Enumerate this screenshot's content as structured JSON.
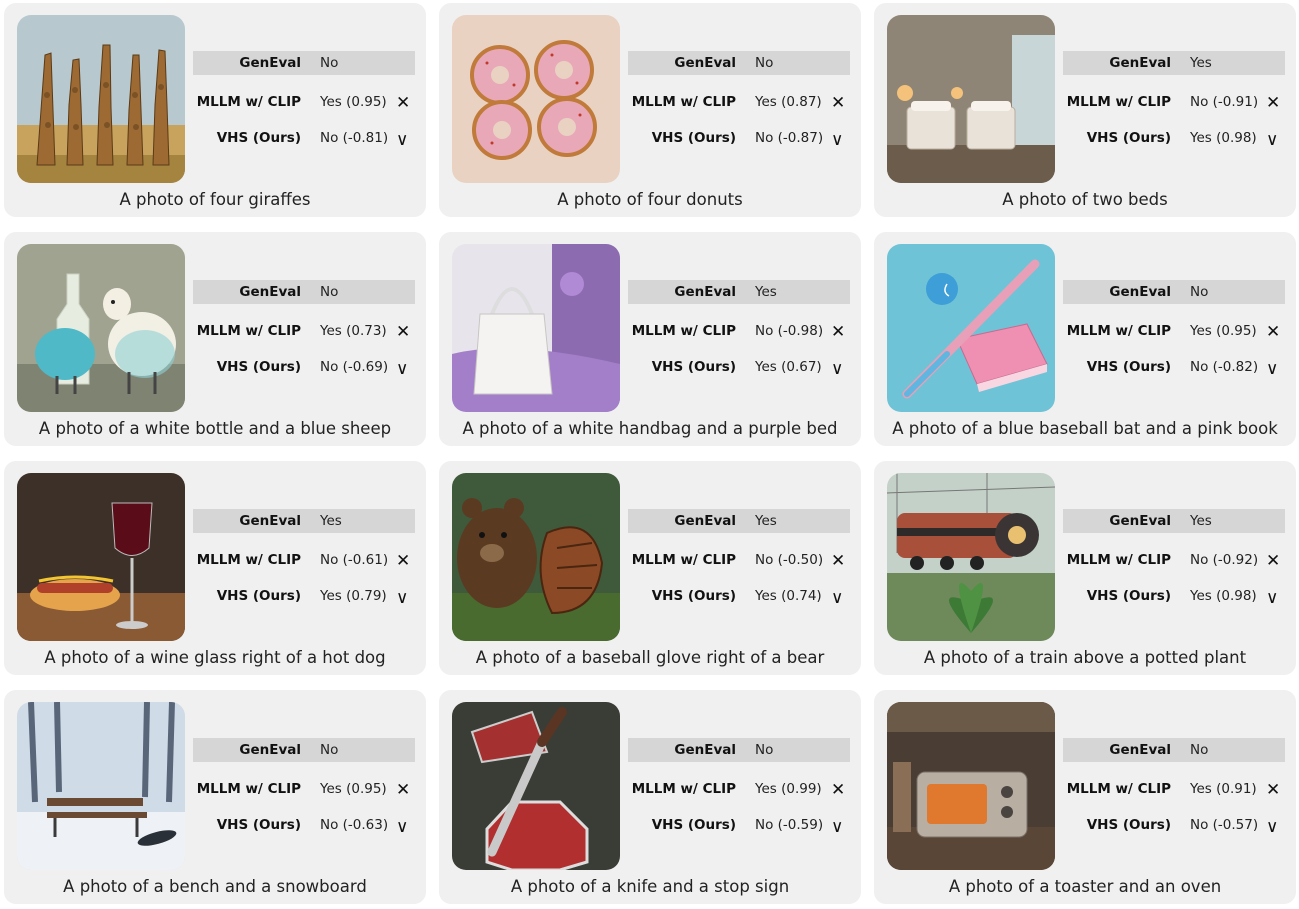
{
  "labels": {
    "geneval": "GenEval",
    "mllm": "MLLM w/ CLIP",
    "vhs": "VHS (Ours)"
  },
  "marks": {
    "wrong": "✕",
    "right": "∨"
  },
  "cards": [
    {
      "caption": "A photo of four giraffes",
      "geneval": "No",
      "mllm": "Yes (0.95)",
      "vhs": "No (-0.81)",
      "image": "giraffes"
    },
    {
      "caption": "A photo of four donuts",
      "geneval": "No",
      "mllm": "Yes (0.87)",
      "vhs": "No (-0.87)",
      "image": "donuts"
    },
    {
      "caption": "A photo of two beds",
      "geneval": "Yes",
      "mllm": "No (-0.91)",
      "vhs": "Yes (0.98)",
      "image": "beds"
    },
    {
      "caption": "A photo of a white bottle and a blue sheep",
      "geneval": "No",
      "mllm": "Yes (0.73)",
      "vhs": "No (-0.69)",
      "image": "bottle-sheep"
    },
    {
      "caption": "A photo of a white handbag and a purple bed",
      "geneval": "Yes",
      "mllm": "No (-0.98)",
      "vhs": "Yes (0.67)",
      "image": "handbag-bed"
    },
    {
      "caption": "A photo of a blue baseball bat and a pink book",
      "geneval": "No",
      "mllm": "Yes (0.95)",
      "vhs": "No (-0.82)",
      "image": "bat-book"
    },
    {
      "caption": "A photo of a wine glass right of a hot dog",
      "geneval": "Yes",
      "mllm": "No (-0.61)",
      "vhs": "Yes (0.79)",
      "image": "wine-hotdog"
    },
    {
      "caption": "A photo of a baseball glove right of a bear",
      "geneval": "Yes",
      "mllm": "No (-0.50)",
      "vhs": "Yes (0.74)",
      "image": "glove-bear"
    },
    {
      "caption": "A photo of a train above a potted plant",
      "geneval": "Yes",
      "mllm": "No (-0.92)",
      "vhs": "Yes (0.98)",
      "image": "train-plant"
    },
    {
      "caption": "A photo of a bench and a snowboard",
      "geneval": "No",
      "mllm": "Yes (0.95)",
      "vhs": "No (-0.63)",
      "image": "bench-snowboard"
    },
    {
      "caption": "A photo of a knife and a stop sign",
      "geneval": "No",
      "mllm": "Yes (0.99)",
      "vhs": "No (-0.59)",
      "image": "knife-stop"
    },
    {
      "caption": "A photo of a toaster and an oven",
      "geneval": "No",
      "mllm": "Yes (0.91)",
      "vhs": "No (-0.57)",
      "image": "toaster-oven"
    }
  ]
}
